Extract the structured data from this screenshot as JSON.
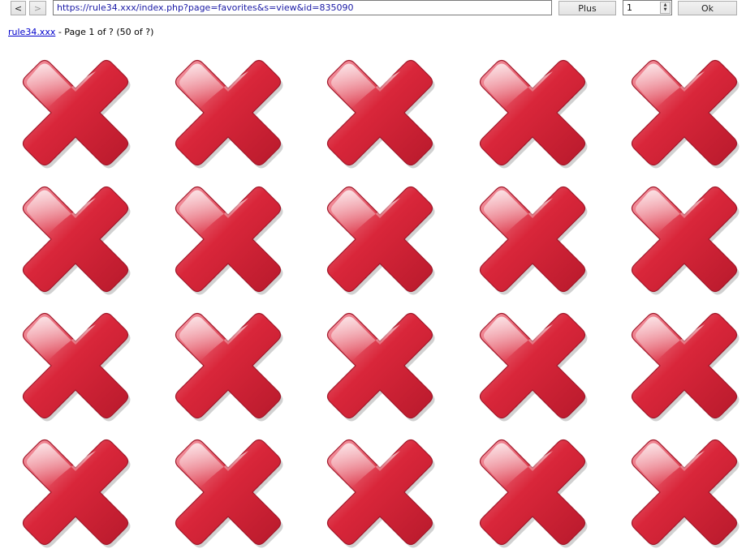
{
  "toolbar": {
    "back_label": "<",
    "forward_label": ">",
    "url": "https://rule34.xxx/index.php?page=favorites&s=view&id=835090",
    "plus_label": "Plus",
    "page_value": "1",
    "ok_label": "Ok"
  },
  "header": {
    "site_link": "rule34.xxx",
    "page_info": " - Page 1 of ? (50 of ?)"
  },
  "grid": {
    "rows": 4,
    "cols": 5,
    "thumbnail_icon": "broken-image-red-x-icon",
    "accent_color": "#d9263a"
  }
}
